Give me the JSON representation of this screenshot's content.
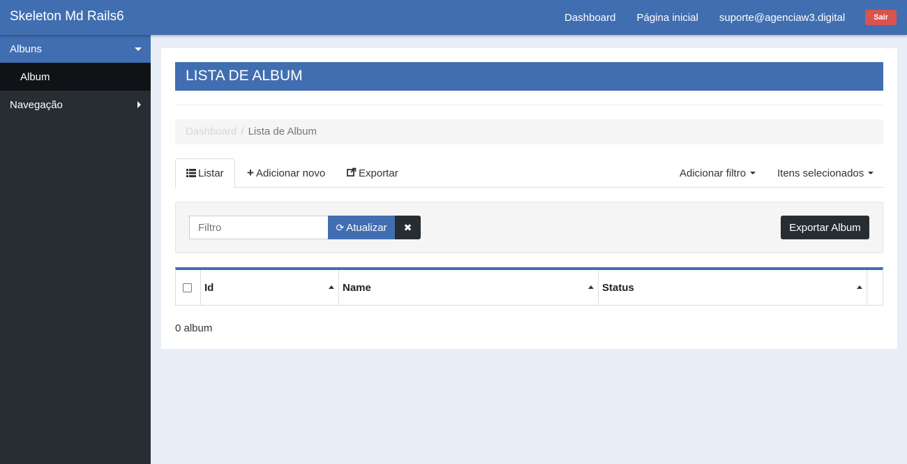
{
  "navbar": {
    "brand": "Skeleton Md Rails6",
    "links": [
      "Dashboard",
      "Página inicial",
      "suporte@agenciaw3.digital"
    ],
    "logout": "Sair"
  },
  "sidebar": {
    "items": [
      {
        "label": "Albuns",
        "expanded": true,
        "children": [
          "Album"
        ]
      },
      {
        "label": "Navegação",
        "expanded": false
      }
    ]
  },
  "page": {
    "title": "LISTA DE ALBUM",
    "breadcrumb": {
      "home": "Dashboard",
      "current": "Lista de Album"
    },
    "tabs": {
      "list": "Listar",
      "add": "Adicionar novo",
      "export": "Exportar",
      "add_filter": "Adicionar filtro",
      "selected": "Itens selecionados"
    },
    "filter": {
      "placeholder": "Filtro",
      "update": "Atualizar",
      "export_button": "Exportar Album"
    },
    "table": {
      "columns": [
        "Id",
        "Name",
        "Status"
      ]
    },
    "count": "0 album"
  },
  "colors": {
    "primary": "#416eb0",
    "dark": "#262d33",
    "danger": "#d9534f"
  }
}
